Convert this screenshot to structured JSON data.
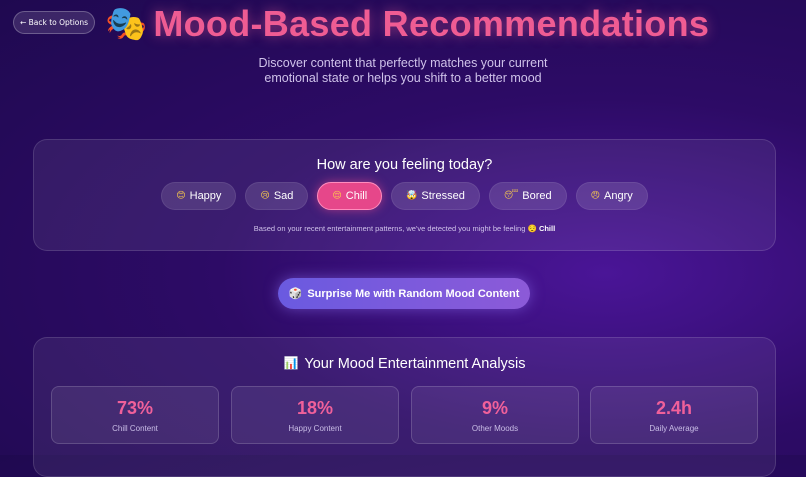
{
  "nav": {
    "back_label": "← Back to Options"
  },
  "header": {
    "emoji": "🎭",
    "title": "Mood-Based Recommendations",
    "subtitle_line1": "Discover content that perfectly matches your current",
    "subtitle_line2": "emotional state or helps you shift to a better mood"
  },
  "mood_selector": {
    "question": "How are you feeling today?",
    "moods": [
      {
        "emoji": "😊",
        "label": "Happy",
        "active": false
      },
      {
        "emoji": "😢",
        "label": "Sad",
        "active": false
      },
      {
        "emoji": "😌",
        "label": "Chill",
        "active": true
      },
      {
        "emoji": "🤯",
        "label": "Stressed",
        "active": false
      },
      {
        "emoji": "😴",
        "label": "Bored",
        "active": false
      },
      {
        "emoji": "😠",
        "label": "Angry",
        "active": false
      }
    ],
    "detected_prefix": "Based on your recent entertainment patterns, we've detected you might be feeling",
    "detected_emoji": "😌",
    "detected_mood": "Chill"
  },
  "surprise_button": {
    "emoji": "🎲",
    "label": "Surprise Me with Random Mood Content"
  },
  "analysis": {
    "emoji": "📊",
    "title": "Your Mood Entertainment Analysis",
    "stats": [
      {
        "value": "73%",
        "label": "Chill Content"
      },
      {
        "value": "18%",
        "label": "Happy Content"
      },
      {
        "value": "9%",
        "label": "Other Moods"
      },
      {
        "value": "2.4h",
        "label": "Daily Average"
      }
    ]
  },
  "colors": {
    "accent": "#ef5c93",
    "active_mood": "#e6478a",
    "button": "#7a5ae0",
    "background": "#2d0b66"
  }
}
